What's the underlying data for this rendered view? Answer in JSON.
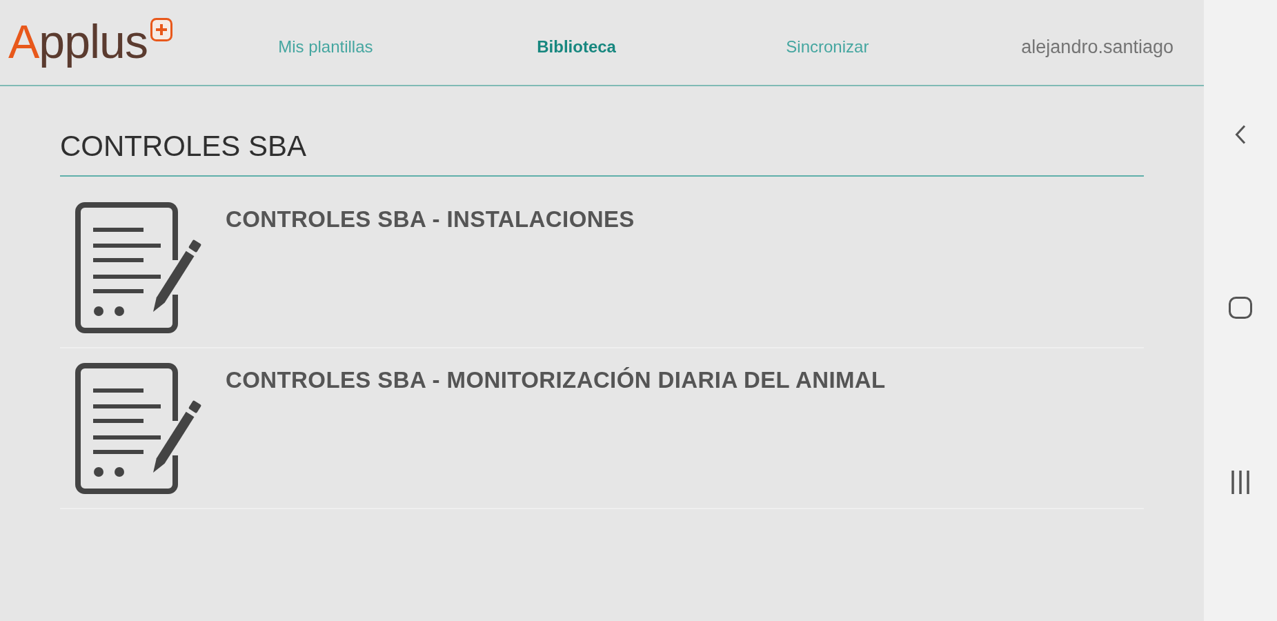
{
  "header": {
    "logo": "Applus",
    "nav": [
      {
        "label": "Mis plantillas",
        "selected": false
      },
      {
        "label": "Biblioteca",
        "selected": true
      },
      {
        "label": "Sincronizar",
        "selected": false
      }
    ],
    "user": "alejandro.santiago"
  },
  "library": {
    "title": "CONTROLES SBA",
    "items": [
      {
        "title": "CONTROLES SBA - INSTALACIONES"
      },
      {
        "title": "CONTROLES SBA - MONITORIZACIÓN DIARIA DEL ANIMAL"
      }
    ]
  }
}
